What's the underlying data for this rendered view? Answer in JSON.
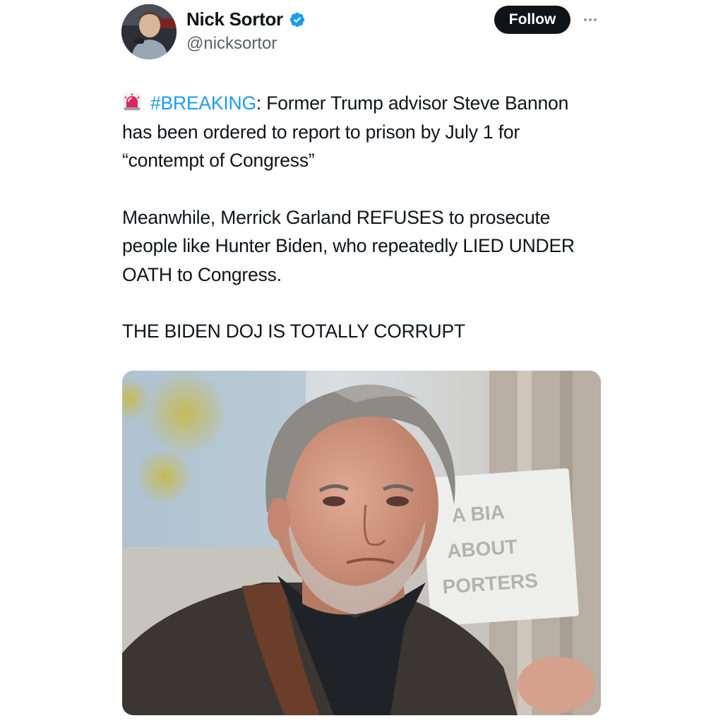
{
  "author": {
    "display_name": "Nick Sortor",
    "handle": "@nicksortor",
    "verified": true,
    "avatar_icon": "profile-photo"
  },
  "actions": {
    "follow_label": "Follow",
    "more_icon": "more-horizontal-icon"
  },
  "tweet": {
    "emoji_icon": "police-siren-icon",
    "hashtag": "#BREAKING",
    "line1_rest": ": Former Trump advisor Steve Bannon has been ordered to report to prison by July 1 for “contempt of Congress”",
    "paragraph2": "Meanwhile, Merrick Garland REFUSES to prosecute people like Hunter Biden, who repeatedly LIED UNDER OATH to Congress.",
    "paragraph3": "THE BIDEN DOJ IS TOTALLY CORRUPT"
  },
  "media": {
    "type": "photo",
    "subject": "news-photo"
  },
  "colors": {
    "hashtag": "#1d9bf0",
    "verified": "#1d9bf0",
    "follow_bg": "#0f1419",
    "text": "#0f1419",
    "secondary": "#536471"
  }
}
